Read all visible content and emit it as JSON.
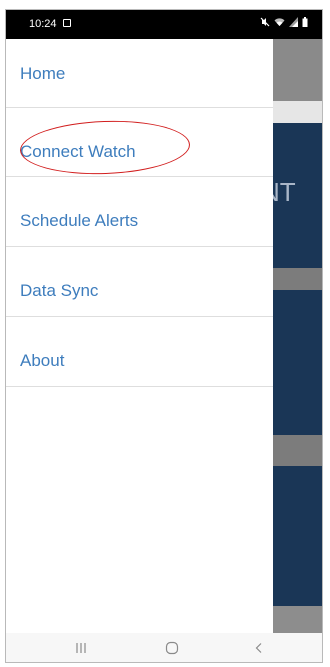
{
  "status_bar": {
    "time": "10:24",
    "icons": [
      "notification-icon",
      "mute-icon",
      "wifi-icon",
      "signal-icon",
      "battery-icon"
    ]
  },
  "background_app": {
    "heading_fragment": "NT",
    "colors": {
      "toolbar": "#8a8a8a",
      "card": "#1a3656",
      "separator": "#7c7c7c"
    }
  },
  "drawer": {
    "items": [
      {
        "label": "Home"
      },
      {
        "label": "Connect Watch",
        "highlighted": true
      },
      {
        "label": "Schedule Alerts"
      },
      {
        "label": "Data Sync"
      },
      {
        "label": "About"
      }
    ],
    "colors": {
      "label": "#3e7dbd",
      "divider": "#dedede",
      "highlight": "#d21f1f"
    }
  },
  "nav_bar": {
    "buttons": [
      "recents-icon",
      "home-icon",
      "back-icon"
    ]
  }
}
